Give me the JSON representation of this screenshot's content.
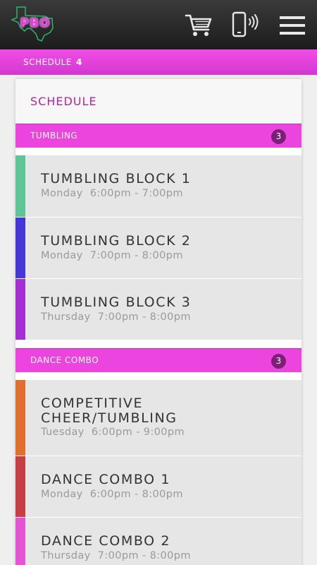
{
  "app": {
    "logo_text": "PBO"
  },
  "header": {
    "icons": [
      "cart-icon",
      "phone-signal-icon",
      "hamburger-menu-icon"
    ]
  },
  "breadcrumb": {
    "label": "SCHEDULE",
    "count": "4"
  },
  "card": {
    "title": "SCHEDULE"
  },
  "sections": [
    {
      "label": "TUMBLING",
      "count": "3",
      "items": [
        {
          "title": "TUMBLING BLOCK 1",
          "day": "Monday",
          "time": "6:00pm - 7:00pm",
          "color": "#5fc596"
        },
        {
          "title": "TUMBLING BLOCK 2",
          "day": "Monday",
          "time": "7:00pm - 8:00pm",
          "color": "#4437d6"
        },
        {
          "title": "TUMBLING BLOCK 3",
          "day": "Thursday",
          "time": "7:00pm - 8:00pm",
          "color": "#a52fd2"
        }
      ]
    },
    {
      "label": "DANCE COMBO",
      "count": "3",
      "items": [
        {
          "title": "COMPETITIVE CHEER/TUMBLING",
          "day": "Tuesday",
          "time": "6:00pm - 9:00pm",
          "color": "#e06f2e"
        },
        {
          "title": "DANCE COMBO 1",
          "day": "Monday",
          "time": "6:00pm - 8:00pm",
          "color": "#c53f44"
        },
        {
          "title": "DANCE COMBO 2",
          "day": "Thursday",
          "time": "7:00pm - 8:00pm",
          "color": "#e455d6"
        }
      ]
    }
  ],
  "colors": {
    "accent": "#ec45df",
    "title": "#b5239f",
    "badge": "#7b1f78"
  }
}
